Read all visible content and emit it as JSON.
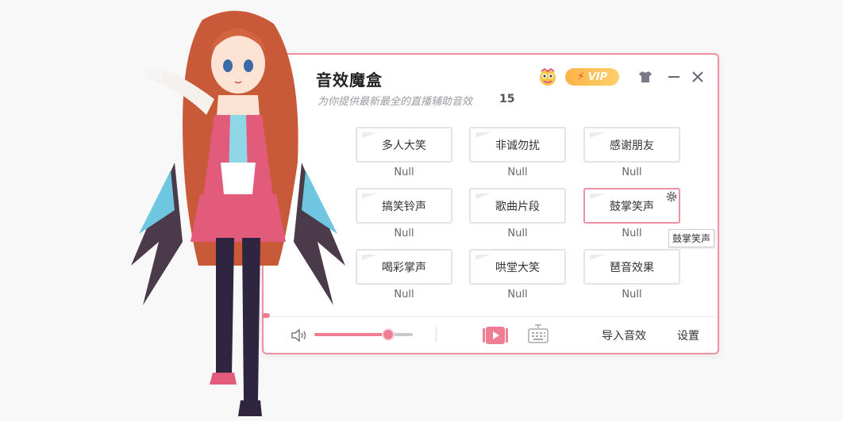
{
  "window": {
    "title": "音效魔盒",
    "subtitle": "为你提供最新最全的直播辅助音效",
    "count": "15"
  },
  "header": {
    "vip_label": "VIP"
  },
  "sounds": [
    {
      "label": "多人大笑",
      "hotkey": "Null"
    },
    {
      "label": "非诚勿扰",
      "hotkey": "Null"
    },
    {
      "label": "感谢朋友",
      "hotkey": "Null"
    },
    {
      "label": "搞笑铃声",
      "hotkey": "Null"
    },
    {
      "label": "歌曲片段",
      "hotkey": "Null"
    },
    {
      "label": "鼓掌笑声",
      "hotkey": "Null"
    },
    {
      "label": "喝彩掌声",
      "hotkey": "Null"
    },
    {
      "label": "哄堂大笑",
      "hotkey": "Null"
    },
    {
      "label": "琶音效果",
      "hotkey": "Null"
    }
  ],
  "tooltip": "鼓掌笑声",
  "volume": {
    "level": 0.75
  },
  "footer": {
    "import_label": "导入音效",
    "settings_label": "设置"
  },
  "icons": [
    "mascot-icon",
    "vip-badge",
    "skin-icon",
    "minimize-icon",
    "close-icon",
    "gear-icon",
    "speaker-icon",
    "play-video-icon",
    "keyboard-icon"
  ],
  "colors": {
    "accent": "#ef7d93",
    "border": "#ef8fa2"
  }
}
